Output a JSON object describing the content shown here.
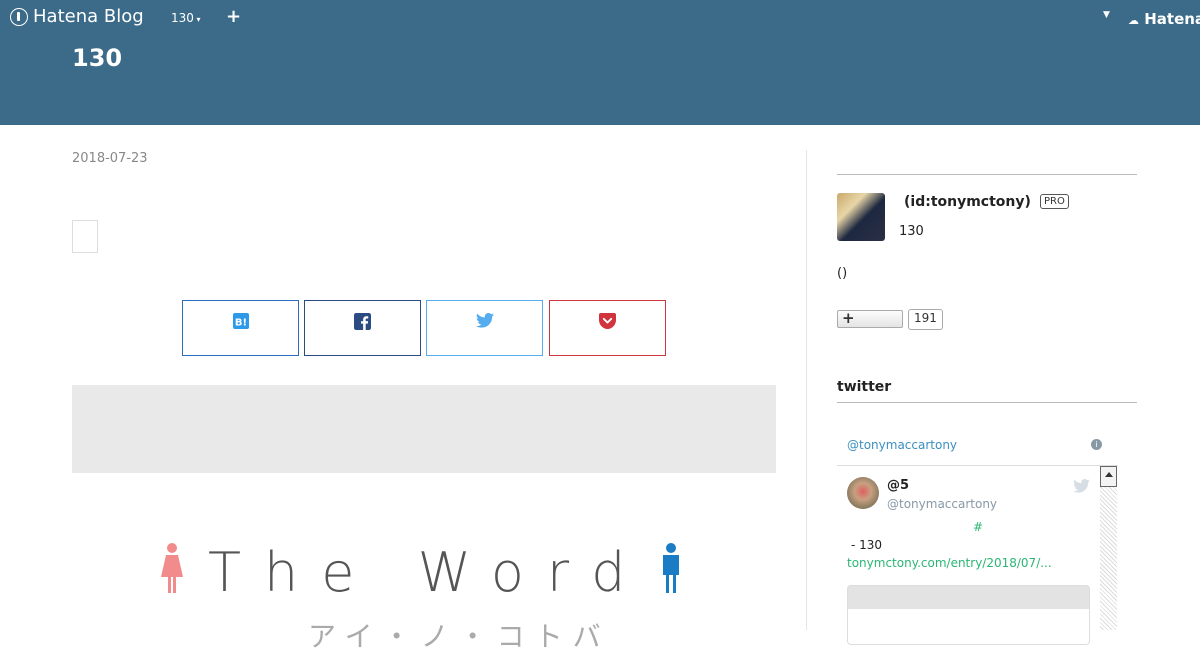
{
  "globalbar": {
    "logo_text": "Hatena Blog",
    "blog_select": "130",
    "add_label": "+",
    "right_logo_text": "Hatena"
  },
  "blog": {
    "title": "130"
  },
  "entry": {
    "date": "2018-07-23",
    "share_buttons": [
      "hatena-bookmark-icon",
      "facebook-icon",
      "twitter-icon",
      "pocket-icon"
    ]
  },
  "hero_image": {
    "title": "The Word",
    "subtitle": "アイ・ノ・コトバ"
  },
  "sidebar": {
    "profile": {
      "name": "(id:tonymctony)",
      "badge": "PRO",
      "description": "130",
      "extra": "()"
    },
    "subscribe": {
      "label": "+",
      "count": "191"
    },
    "twitter": {
      "title": "twitter",
      "widget_link": "@tonymaccartony",
      "tweet": {
        "name": "@5",
        "handle": "@tonymaccartony",
        "hashtag": "#",
        "text": "- 130",
        "link": "tonymctony.com/entry/2018/07/..."
      }
    }
  },
  "colors": {
    "header_bg": "#3c6b8a",
    "hatena_bookmark": "#2c6ebd",
    "facebook": "#2b4b82",
    "twitter": "#55acee",
    "pocket": "#d0343d"
  }
}
